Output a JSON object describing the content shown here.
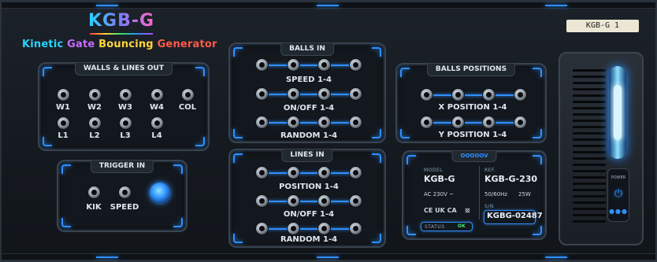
{
  "brand": {
    "title": "KGB-G",
    "subtitle_words": [
      "Kinetic",
      "Gate",
      "Bouncing",
      "Generator"
    ]
  },
  "tag_label": "KGB-G 1",
  "walls": {
    "title": "WALLS & LINES OUT",
    "row1": [
      "W1",
      "W2",
      "W3",
      "W4",
      "COL"
    ],
    "row2": [
      "L1",
      "L2",
      "L3",
      "L4"
    ]
  },
  "trigger": {
    "title": "TRIGGER IN",
    "labels": [
      "KIK",
      "SPEED"
    ]
  },
  "balls_in": {
    "title": "BALLS IN",
    "rows": [
      "SPEED 1-4",
      "ON/OFF 1-4",
      "RANDOM 1-4"
    ]
  },
  "lines_in": {
    "title": "LINES IN",
    "rows": [
      "POSITION 1-4",
      "ON/OFF 1-4",
      "RANDOM 1-4"
    ]
  },
  "balls_positions": {
    "title": "BALLS POSITIONS",
    "rows": [
      "X POSITION 1-4",
      "Y POSITION 1-4"
    ]
  },
  "info": {
    "header": "OOOOOV",
    "model_label": "MODEL",
    "model_value": "KGB-G",
    "ref_label": "REF.",
    "ref_value": "KGB-G-230",
    "voltage": "AC 230V ~",
    "frequency": "50/60Hz",
    "power": "25W",
    "marks": "CE UK CA",
    "sn_label": "S/N",
    "serial": "KGBG-02487",
    "status_label": "STATUS",
    "status_value": "OK"
  },
  "power": {
    "label": "POWER",
    "icon": "power-icon",
    "dots": "●●●"
  },
  "colors": {
    "accent": "#2f8fff",
    "title_c1": "#27d3ff",
    "title_c2": "#c86bff",
    "title_c3": "#ffd43b",
    "title_c4": "#ff5a4a"
  }
}
